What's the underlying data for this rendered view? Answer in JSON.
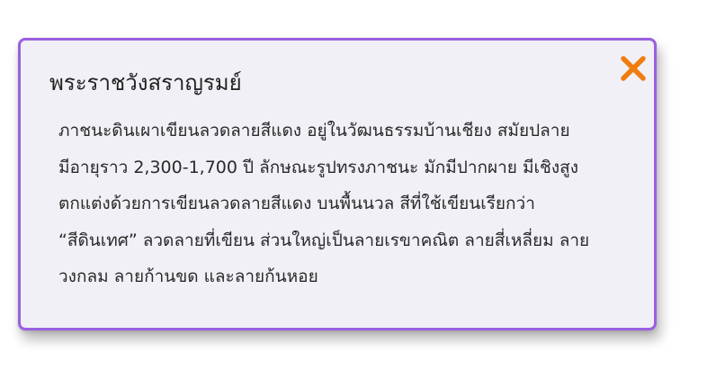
{
  "popup": {
    "title": "พระราชวังสราญรมย์",
    "body_lines": [
      "ภาชนะดินเผาเขียนลวดลายสีแดง อยู่ในวัฒนธรรมบ้านเชียง สมัยปลาย",
      "มีอายุราว 2,300-1,700 ปี ลักษณะรูปทรงภาชนะ มักมีปากผาย มีเชิงสูง",
      "ตกแต่งด้วยการเขียนลวดลายสีแดง บนพื้นนวล สีที่ใช้เขียนเรียกว่า",
      "“สีดินเทศ” ลวดลายที่เขียน ส่วนใหญ่เป็นลายเรขาคณิต ลายสี่เหลี่ยม ลาย",
      "วงกลม ลายก้านขด และลายก้นหอย"
    ],
    "close_icon": "close-x-icon"
  },
  "colors": {
    "border": "#9a60e0",
    "background": "#f0f0f6",
    "close_icon": "#f07d10",
    "text": "#2a2a2a"
  }
}
